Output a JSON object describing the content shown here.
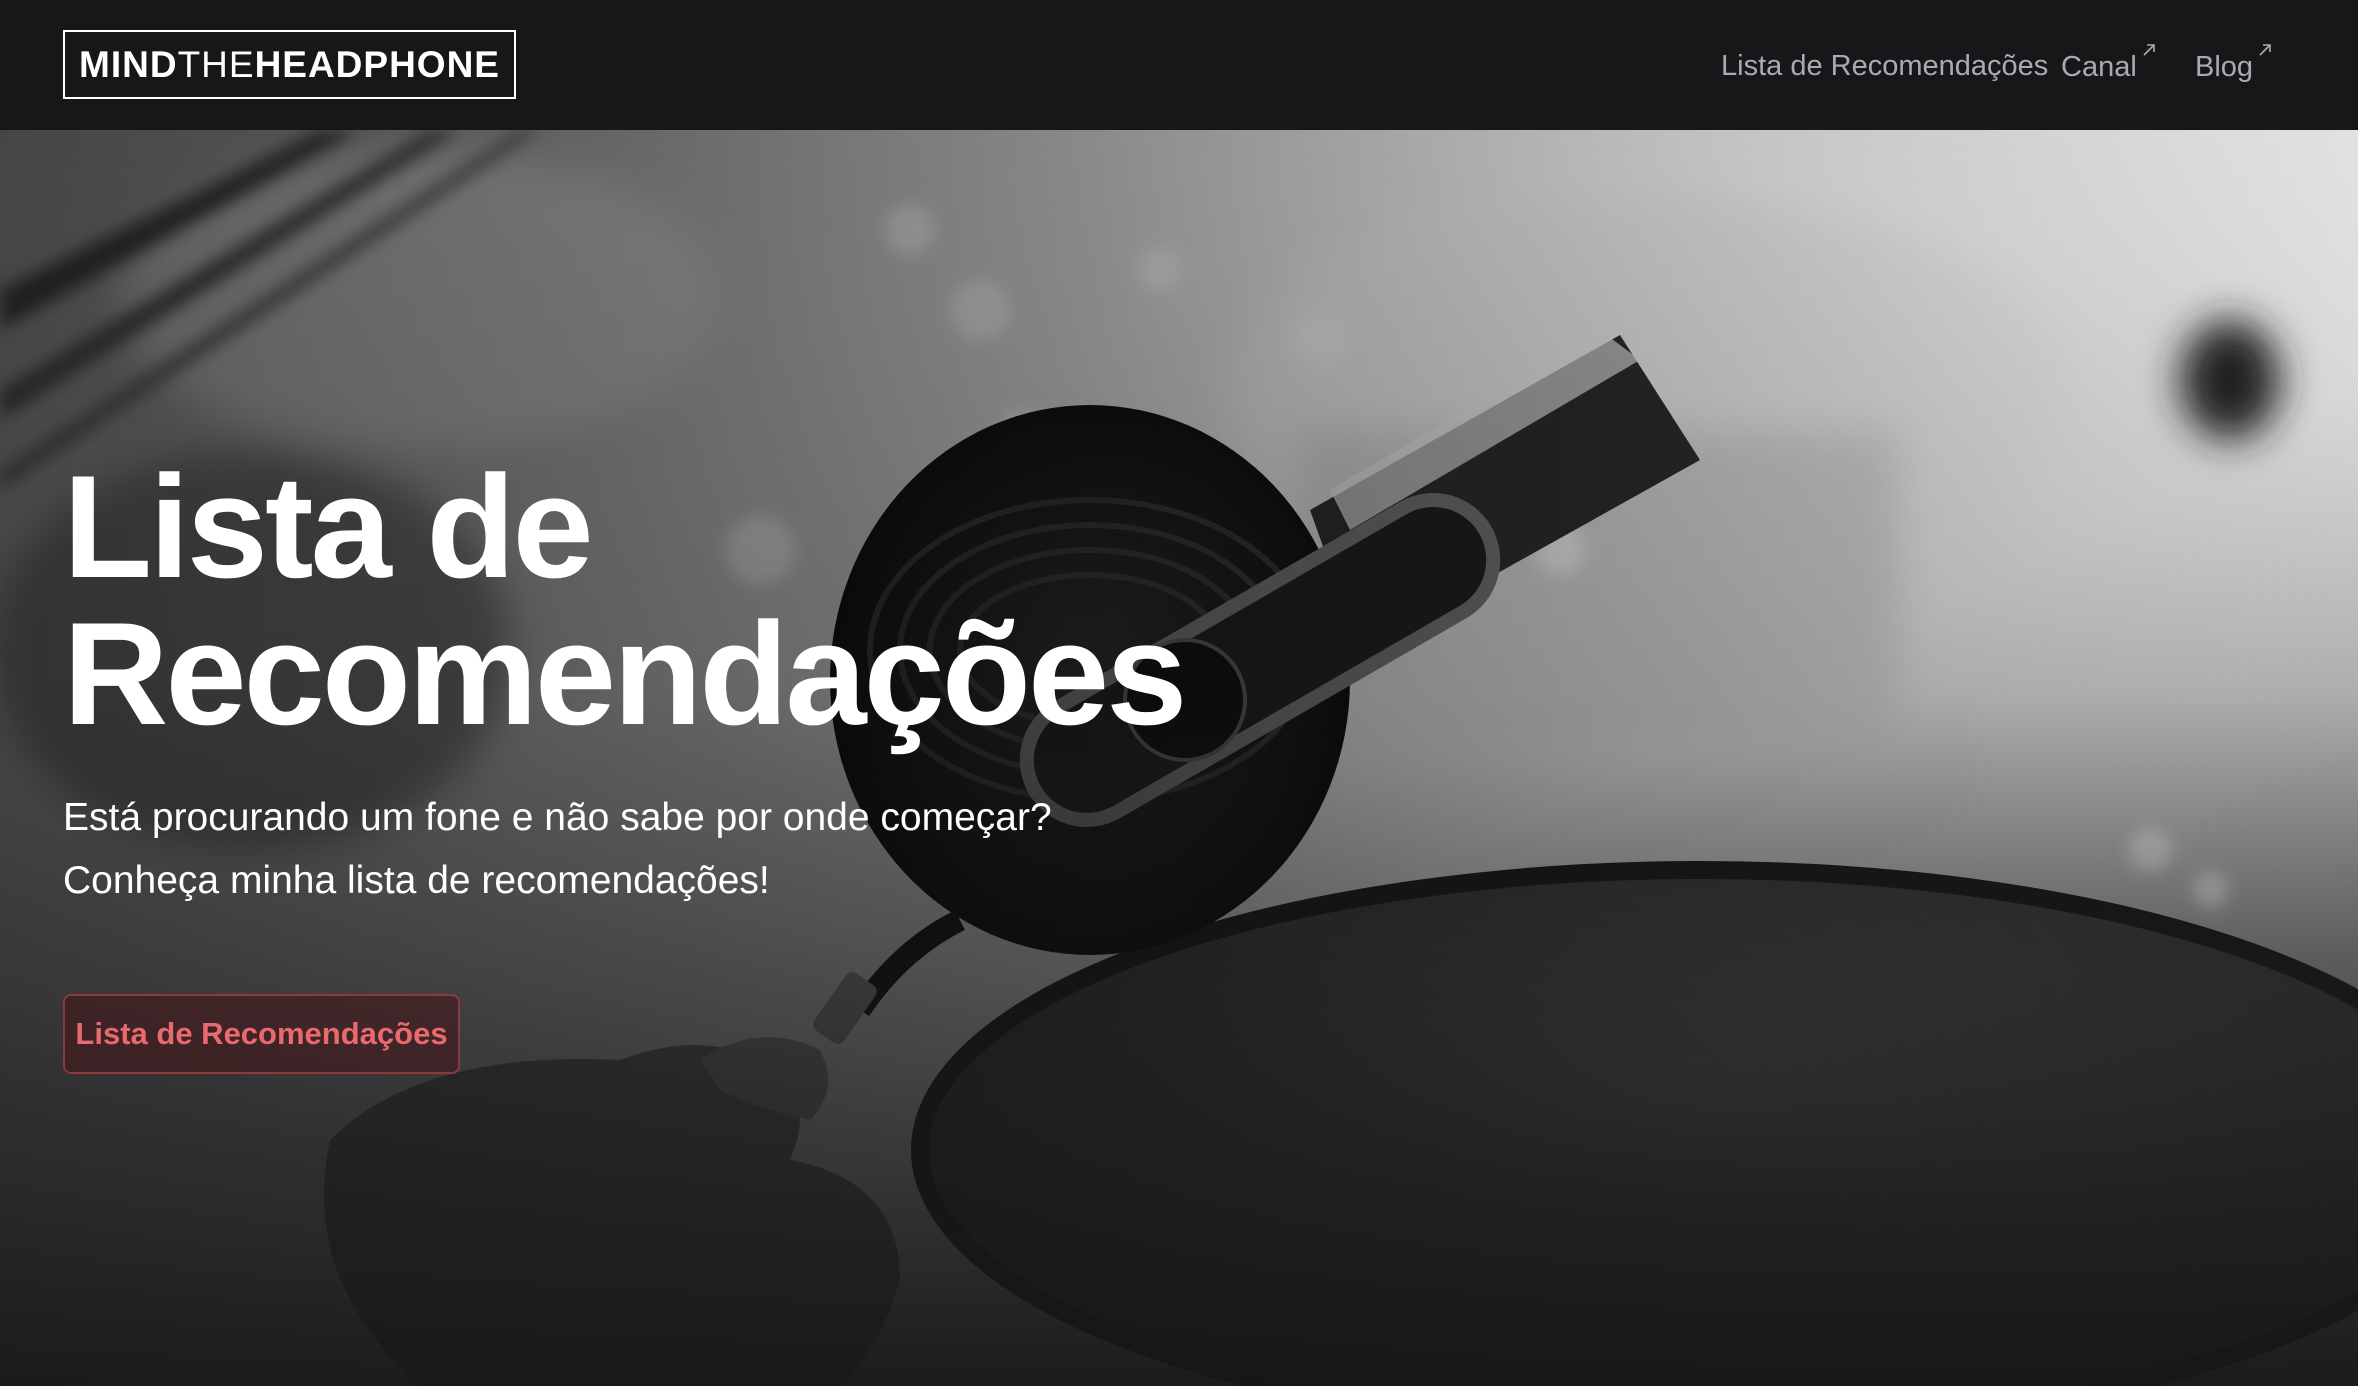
{
  "brand": {
    "part1": "MIND",
    "part2": "THE",
    "part3": "HEADPHONE"
  },
  "nav": {
    "items": [
      {
        "label": "Lista de Recomendações",
        "external": false
      },
      {
        "label": "Canal",
        "external": true
      },
      {
        "label": "Blog",
        "external": true
      }
    ]
  },
  "hero": {
    "title_line1": "Lista de",
    "title_line2": "Recomendações",
    "subtitle_line1": "Está procurando um fone e não sabe por onde começar?",
    "subtitle_line2": "Conheça minha lista de recomendações!",
    "cta_label": "Lista de Recomendações",
    "background_image": "black-and-white photo of a hand holding a headphone with an audio jack"
  },
  "icons": {
    "external_link": "arrow-up-right-icon"
  },
  "colors": {
    "navbar_bg": "#17171a",
    "nav_text": "#a9abb0",
    "cta_text": "#e86a6f",
    "cta_border": "#8c3a3e"
  }
}
